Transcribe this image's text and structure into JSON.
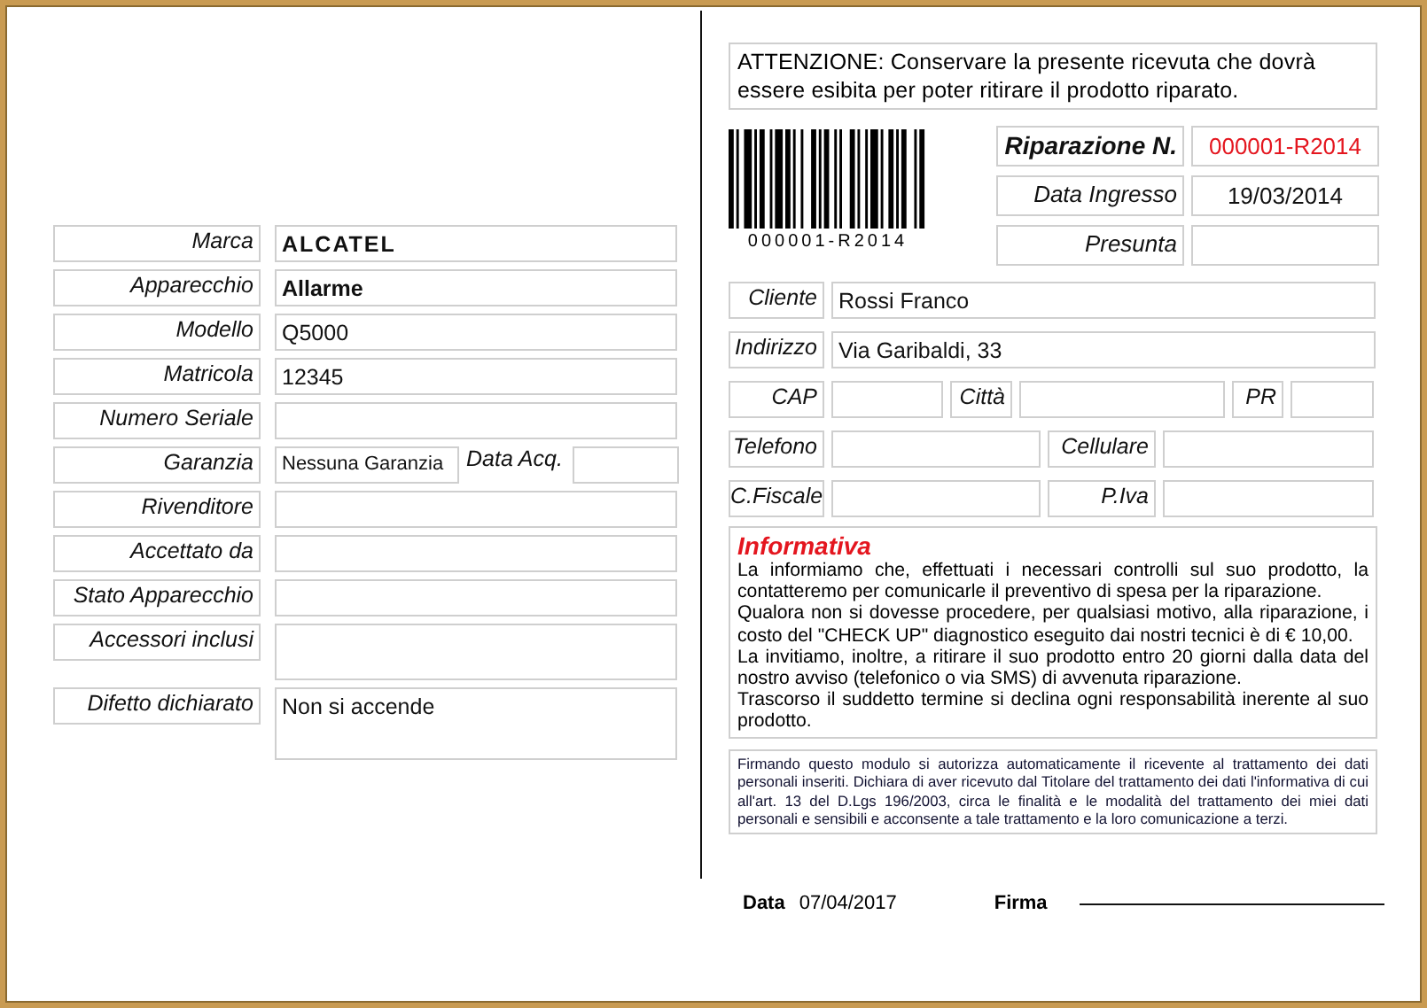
{
  "device_fields": [
    {
      "kind": "line",
      "label": "Marca",
      "value": "ALCATEL",
      "bold": true
    },
    {
      "kind": "line",
      "label": "Apparecchio",
      "value": "Allarme",
      "bold": true
    },
    {
      "kind": "line",
      "label": "Modello",
      "value": "Q5000",
      "bold": false
    },
    {
      "kind": "line",
      "label": "Matricola",
      "value": "12345",
      "bold": false
    },
    {
      "kind": "line",
      "label": "Numero Seriale"
    },
    {
      "kind": "warranty",
      "label": "Garanzia",
      "value": "Nessuna Garanzia",
      "extra_label": "Data Acq.",
      "bold": false
    },
    {
      "kind": "line",
      "label": "Rivenditore"
    },
    {
      "kind": "line",
      "label": "Accettato da"
    },
    {
      "kind": "line",
      "label": "Stato Apparecchio"
    },
    {
      "kind": "tall",
      "label": "Accessori inclusi"
    },
    {
      "kind": "taller",
      "label": "Difetto dichiarato",
      "value": "Non si accende",
      "bold": false
    }
  ],
  "notice": "ATTENZIONE: Conservare la presente ricevuta che dovrà essere esibita per poter ritirare il prodotto riparato.",
  "barcode_text": "000001-R2014",
  "repair": {
    "title": "Riparazione N.",
    "number": "000001-R2014",
    "rows": [
      {
        "label": "Data Ingresso",
        "value": "19/03/2014"
      },
      {
        "label": "Presunta"
      }
    ]
  },
  "customer": {
    "rows": [
      [
        {
          "label": "Cliente",
          "value": "Rossi Franco",
          "kind": "wide"
        }
      ],
      [
        {
          "label": "Indirizzo",
          "value": "Via Garibaldi, 33",
          "kind": "wide"
        }
      ],
      [
        {
          "label": "CAP",
          "kind": "cap"
        },
        {
          "label": "Città",
          "kind": "city"
        },
        {
          "label": "PR",
          "kind": "pr"
        }
      ],
      [
        {
          "label": "Telefono",
          "kind": "half"
        },
        {
          "label": "Cellulare",
          "kind": "half2"
        }
      ],
      [
        {
          "label": "C.Fiscale",
          "kind": "half"
        },
        {
          "label": "P.Iva",
          "kind": "half2"
        }
      ]
    ]
  },
  "informativa": {
    "title": "Informativa",
    "paragraphs": [
      "La informiamo che, effettuati i necessari controlli sul suo prodotto, la contatteremo per comunicarle il preventivo di spesa per la riparazione.",
      "Qualora non si dovesse procedere, per qualsiasi motivo, alla riparazione, i costo del \"CHECK UP\" diagnostico eseguito dai nostri tecnici è di € 10,00.",
      "La invitiamo, inoltre, a ritirare il suo prodotto entro 20 giorni dalla data del nostro avviso (telefonico o via SMS) di avvenuta riparazione.",
      "Trascorso il suddetto termine si declina ogni responsabilità inerente al suo prodotto."
    ]
  },
  "privacy": "Firmando questo modulo si autorizza automaticamente il ricevente al trattamento dei dati personali inseriti. Dichiara di aver ricevuto dal Titolare del trattamento dei dati l'informativa di cui all'art. 13 del D.Lgs 196/2003, circa le finalità e le modalità del trattamento dei miei dati personali e sensibili e acconsente a tale trattamento e la loro comunicazione a terzi.",
  "footer": {
    "date_label": "Data",
    "date": "07/04/2017",
    "signature_label": "Firma"
  }
}
